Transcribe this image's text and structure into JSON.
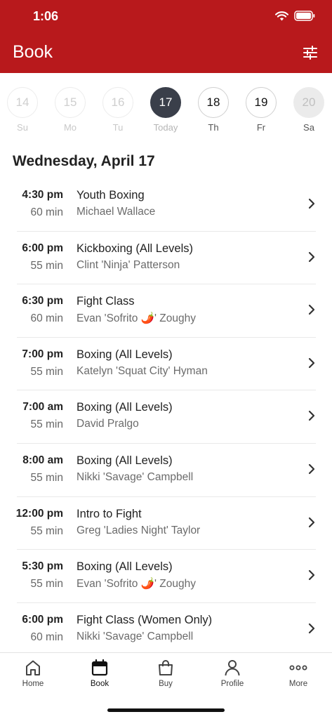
{
  "status_bar": {
    "time": "1:06"
  },
  "header": {
    "title": "Book",
    "filter_icon": "sliders-icon"
  },
  "colors": {
    "brand": "#b8191c",
    "today": "#3a3f4a"
  },
  "days": [
    {
      "num": "14",
      "label": "Su",
      "state": "past"
    },
    {
      "num": "15",
      "label": "Mo",
      "state": "past"
    },
    {
      "num": "16",
      "label": "Tu",
      "state": "past"
    },
    {
      "num": "17",
      "label": "Today",
      "state": "today"
    },
    {
      "num": "18",
      "label": "Th",
      "state": "future"
    },
    {
      "num": "19",
      "label": "Fr",
      "state": "future"
    },
    {
      "num": "20",
      "label": "Sa",
      "state": "disabled"
    }
  ],
  "date_heading": "Wednesday, April 17",
  "classes": [
    {
      "time": "4:30 pm",
      "duration": "60 min",
      "name": "Youth Boxing",
      "instructor": "Michael Wallace"
    },
    {
      "time": "6:00 pm",
      "duration": "55 min",
      "name": "Kickboxing (All Levels)",
      "instructor": "Clint 'Ninja' Patterson"
    },
    {
      "time": "6:30 pm",
      "duration": "60 min",
      "name": "Fight Class",
      "instructor": "Evan 'Sofrito 🌶️' Zoughy"
    },
    {
      "time": "7:00 pm",
      "duration": "55 min",
      "name": "Boxing (All Levels)",
      "instructor": "Katelyn 'Squat City' Hyman"
    },
    {
      "time": "7:00 am",
      "duration": "55 min",
      "name": "Boxing (All Levels)",
      "instructor": "David Pralgo"
    },
    {
      "time": "8:00 am",
      "duration": "55 min",
      "name": "Boxing (All Levels)",
      "instructor": "Nikki 'Savage' Campbell"
    },
    {
      "time": "12:00 pm",
      "duration": "55 min",
      "name": "Intro to Fight",
      "instructor": "Greg 'Ladies Night' Taylor"
    },
    {
      "time": "5:30 pm",
      "duration": "55 min",
      "name": "Boxing (All Levels)",
      "instructor": "Evan 'Sofrito 🌶️' Zoughy"
    },
    {
      "time": "6:00 pm",
      "duration": "60 min",
      "name": "Fight Class (Women Only)",
      "instructor": "Nikki 'Savage' Campbell"
    }
  ],
  "tabs": [
    {
      "label": "Home",
      "icon": "home-icon"
    },
    {
      "label": "Book",
      "icon": "calendar-icon",
      "active": true
    },
    {
      "label": "Buy",
      "icon": "bag-icon"
    },
    {
      "label": "Profile",
      "icon": "person-icon"
    },
    {
      "label": "More",
      "icon": "more-dots-icon"
    }
  ]
}
